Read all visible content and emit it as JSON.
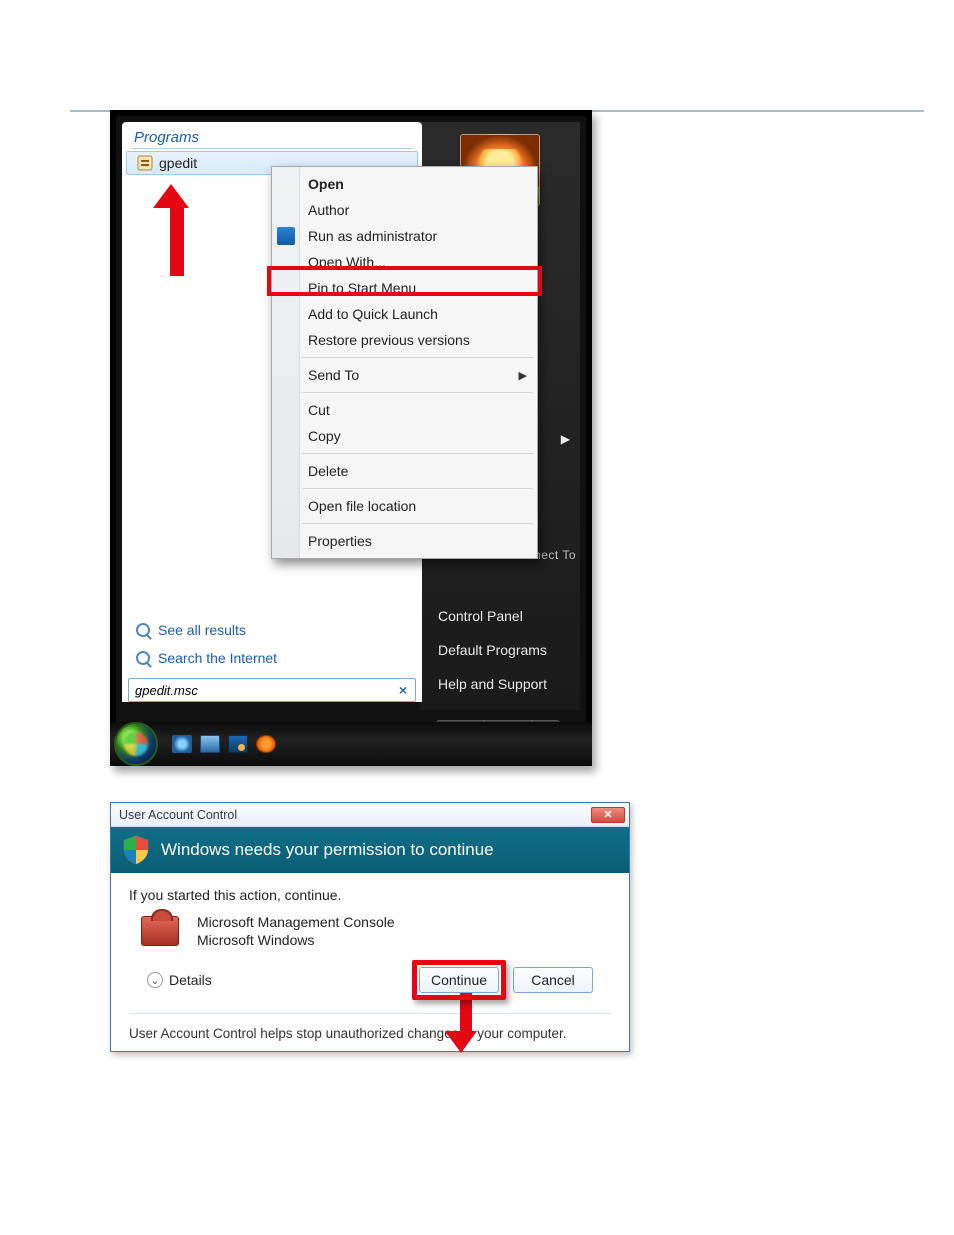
{
  "start_menu": {
    "programs_header": "Programs",
    "result_label": "gpedit",
    "see_all": "See all results",
    "search_internet": "Search the Internet",
    "search_value": "gpedit.msc",
    "right_items": {
      "connect_to": "Connect To",
      "control_panel": "Control Panel",
      "default_programs": "Default Programs",
      "help_support": "Help and Support"
    }
  },
  "context_menu": {
    "open": "Open",
    "author": "Author",
    "run_admin": "Run as administrator",
    "open_with": "Open With...",
    "pin_start": "Pin to Start Menu",
    "quick_launch": "Add to Quick Launch",
    "restore": "Restore previous versions",
    "send_to": "Send To",
    "cut": "Cut",
    "copy": "Copy",
    "delete": "Delete",
    "open_loc": "Open file location",
    "properties": "Properties"
  },
  "uac": {
    "title": "User Account Control",
    "banner": "Windows needs your permission to continue",
    "started": "If you started this action, continue.",
    "app_name": "Microsoft Management Console",
    "app_pub": "Microsoft Windows",
    "details": "Details",
    "continue": "Continue",
    "cancel": "Cancel",
    "footer": "User Account Control helps stop unauthorized changes to your computer."
  }
}
